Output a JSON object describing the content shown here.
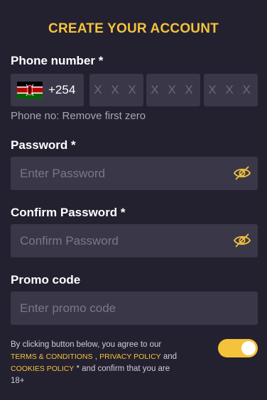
{
  "header": {
    "title": "CREATE YOUR ACCOUNT"
  },
  "phone": {
    "label": "Phone number *",
    "country_flag_icon": "kenya-flag-icon",
    "country_code": "+254",
    "segments": [
      {
        "placeholder": "X X X"
      },
      {
        "placeholder": "X X X"
      },
      {
        "placeholder": "X X X"
      }
    ],
    "hint": "Phone no: Remove first zero"
  },
  "password": {
    "label": "Password *",
    "placeholder": "Enter Password",
    "icon": "eye-off-icon"
  },
  "confirm_password": {
    "label": "Confirm Password *",
    "placeholder": "Confirm Password",
    "icon": "eye-off-icon"
  },
  "promo": {
    "label": "Promo code",
    "placeholder": "Enter promo code"
  },
  "terms": {
    "text_before": "By clicking button below, you agree to our ",
    "terms_link": "TERMS & CONDITIONS",
    "sep1": " , ",
    "privacy_link": "PRIVACY POLICY",
    "sep2": " and ",
    "cookies_link": "COOKIES POLICY",
    "text_after": " * and confirm that you are 18+"
  },
  "agree_toggle": {
    "state": "on"
  },
  "colors": {
    "accent": "#f5c23b",
    "background": "#232130",
    "field": "#3a3848"
  }
}
